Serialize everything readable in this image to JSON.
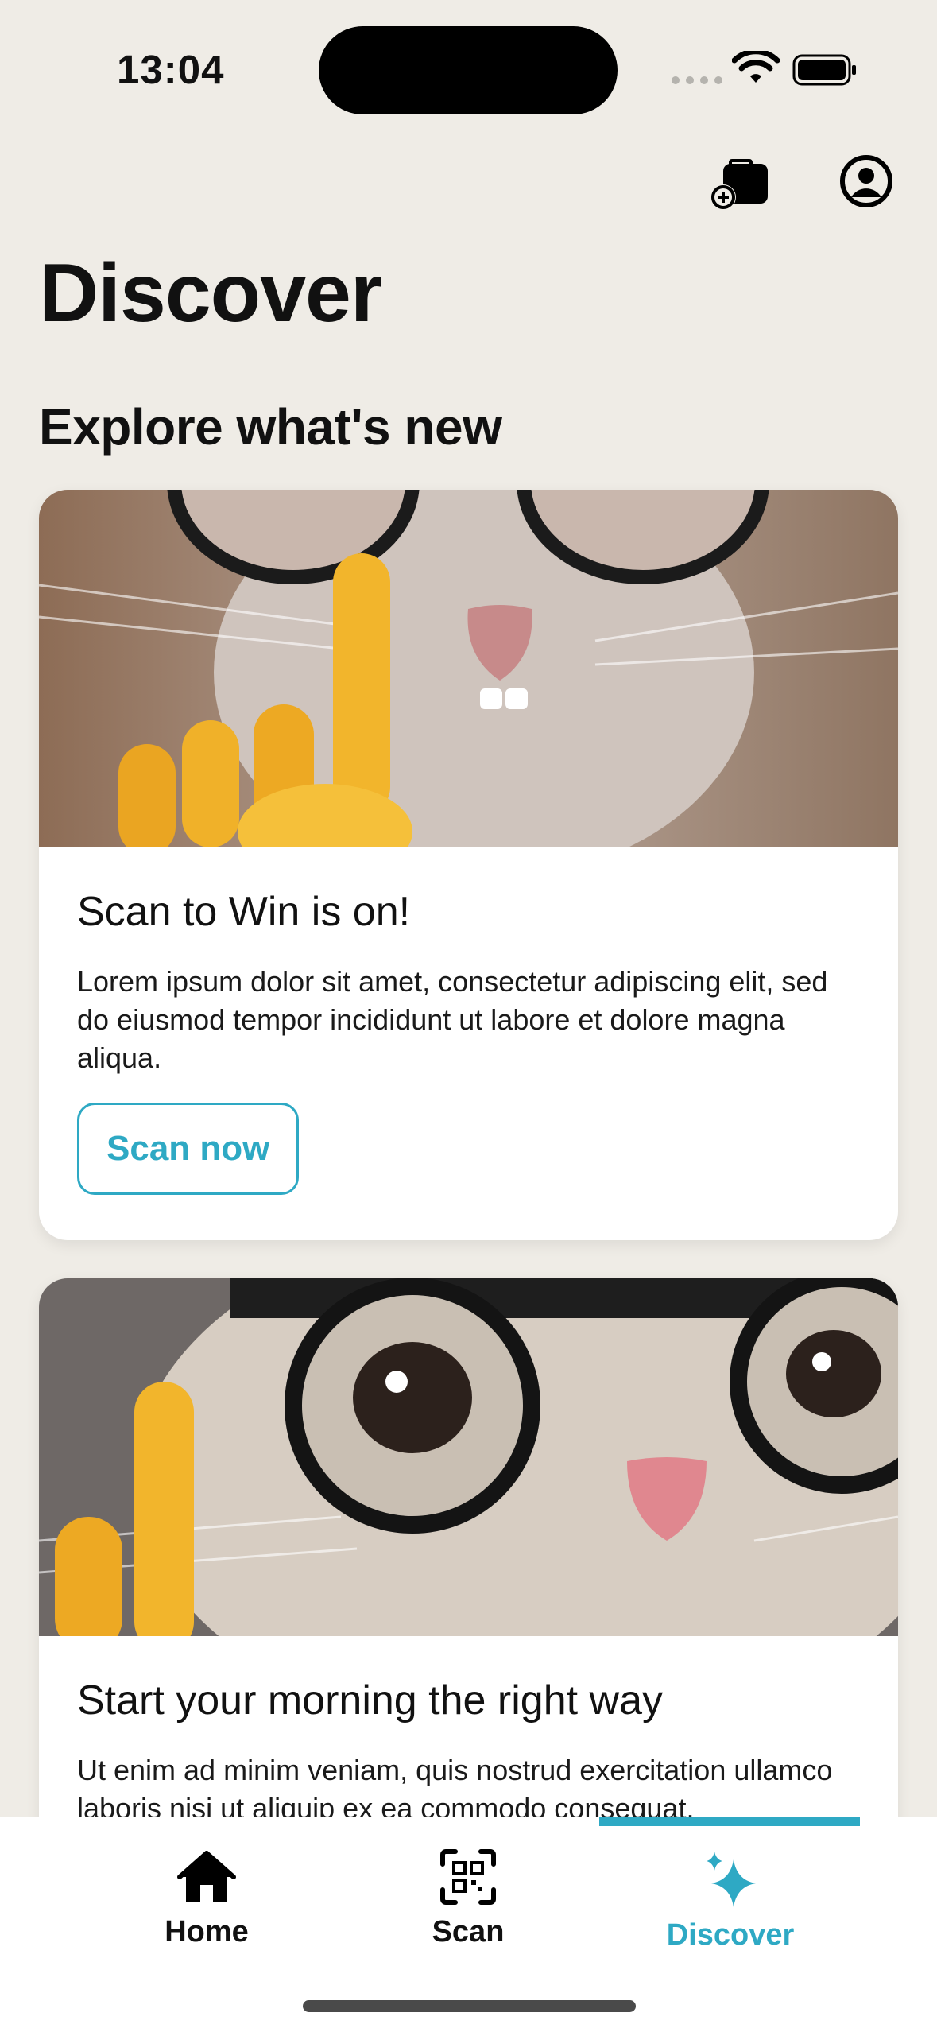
{
  "status_bar": {
    "time": "13:04"
  },
  "header": {
    "title": "Discover"
  },
  "section": {
    "title": "Explore what's new"
  },
  "cards": [
    {
      "title": "Scan to Win is on!",
      "text": "Lorem ipsum dolor sit amet, consectetur adipiscing elit, sed do eiusmod tempor incididunt ut labore et dolore magna aliqua.",
      "cta": "Scan now"
    },
    {
      "title": "Start your morning the right way",
      "text": "Ut enim ad minim veniam, quis nostrud exercitation ullamco laboris nisi ut aliquip ex ea commodo consequat."
    }
  ],
  "tab_bar": {
    "tabs": [
      {
        "label": "Home",
        "icon": "home-icon"
      },
      {
        "label": "Scan",
        "icon": "qr-scan-icon"
      },
      {
        "label": "Discover",
        "icon": "sparkles-icon"
      }
    ],
    "active": "Discover"
  },
  "colors": {
    "accent": "#2ea9c4",
    "background": "#efece6"
  }
}
